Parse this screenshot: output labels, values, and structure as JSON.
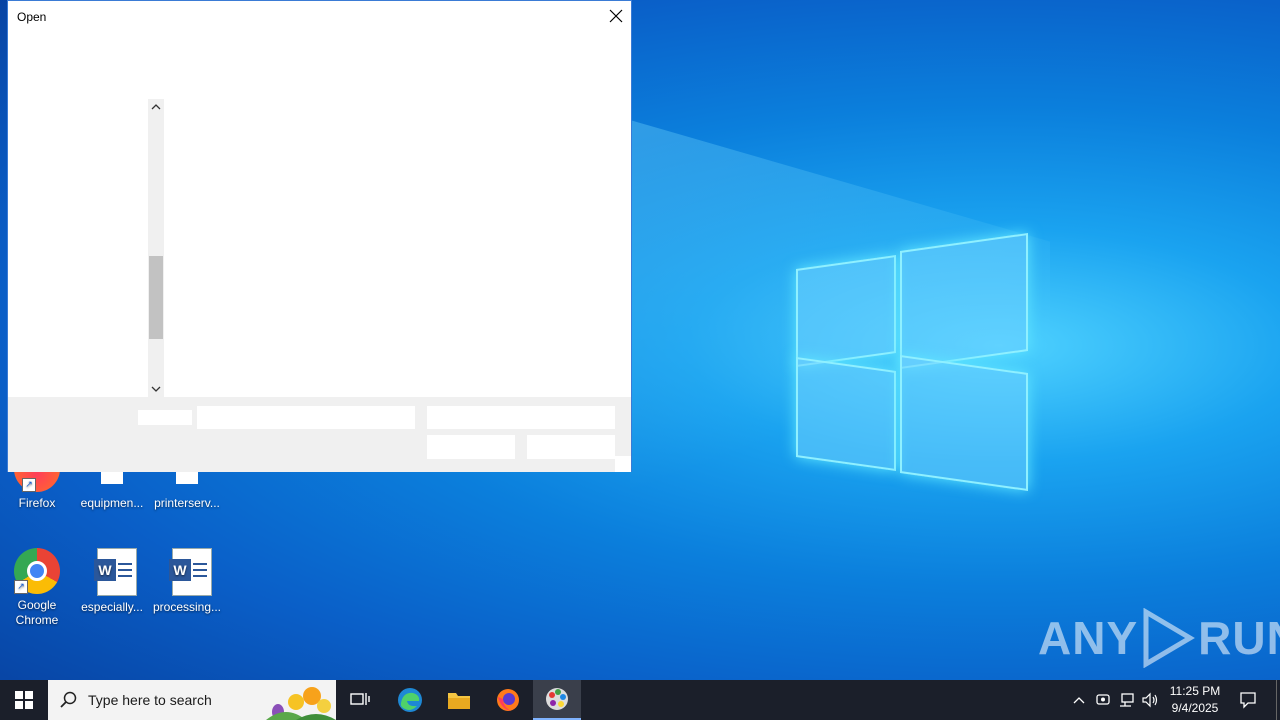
{
  "dialog": {
    "title": "Open"
  },
  "desktop": {
    "icons": [
      {
        "label": "Firefox"
      },
      {
        "label": "equipmen..."
      },
      {
        "label": "printerserv..."
      },
      {
        "label": "Google Chrome"
      },
      {
        "label": "especially..."
      },
      {
        "label": "processing..."
      }
    ]
  },
  "taskbar": {
    "search_placeholder": "Type here to search",
    "clock_time": "11:25 PM",
    "clock_date": "9/4/2025"
  },
  "watermark": {
    "text_left": "ANY",
    "text_right": "RUN"
  },
  "colors": {
    "dialog_border": "#3a7bd5",
    "taskbar_bg": "#1b1f2a",
    "desktop_accent": "#0b7fdc"
  }
}
